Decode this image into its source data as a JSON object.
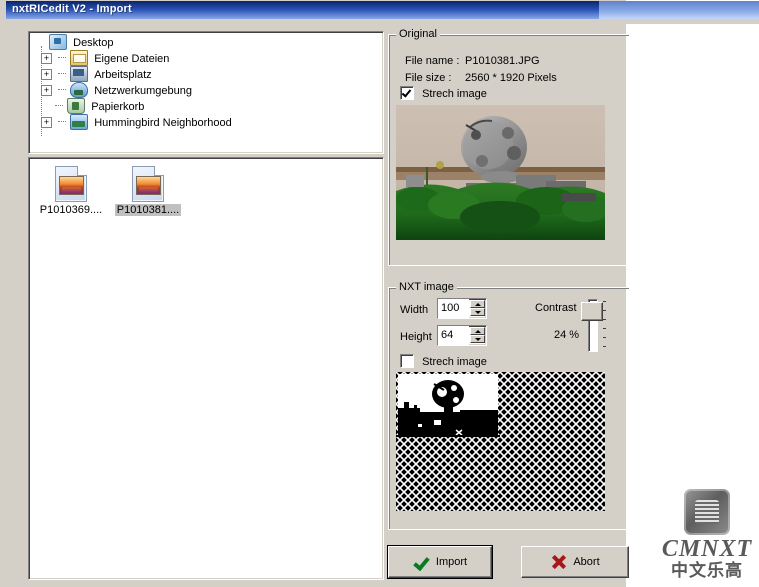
{
  "window": {
    "title": "nxtRICedit V2 - Import",
    "background_color": "#d4d0c8",
    "titlebar_color": "#0a246a"
  },
  "tree": {
    "nodes": [
      {
        "label": "Desktop",
        "icon": "desktop-icon",
        "expander": "",
        "indent": 0
      },
      {
        "label": "Eigene Dateien",
        "icon": "folder-icon",
        "expander": "+",
        "indent": 1
      },
      {
        "label": "Arbeitsplatz",
        "icon": "my-computer-icon",
        "expander": "+",
        "indent": 1
      },
      {
        "label": "Netzwerkumgebung",
        "icon": "network-icon",
        "expander": "+",
        "indent": 1
      },
      {
        "label": "Papierkorb",
        "icon": "recycle-bin-icon",
        "expander": "",
        "indent": 1
      },
      {
        "label": "Hummingbird Neighborhood",
        "icon": "hummingbird-icon",
        "expander": "+",
        "indent": 1
      }
    ]
  },
  "file_list": {
    "items": [
      {
        "label": "P1010369....",
        "icon": "jpeg-file-icon",
        "selected": false
      },
      {
        "label": "P1010381....",
        "icon": "jpeg-file-icon",
        "selected": true
      }
    ]
  },
  "original_group": {
    "title": "Original",
    "file_name_label": "File name :",
    "file_name_value": "P1010381.JPG",
    "file_size_label": "File size   :",
    "file_size_value": "2560 * 1920 Pixels",
    "stretch_label": "Strech image",
    "stretch_checked": true
  },
  "nxt_group": {
    "title": "NXT image",
    "width_label": "Width",
    "width_value": "100",
    "height_label": "Height",
    "height_value": "64",
    "contrast_label": "Contrast",
    "contrast_value": "24 %",
    "stretch_label": "Strech image",
    "stretch_checked": false
  },
  "buttons": {
    "import_label": "Import",
    "import_icon": "green-check-icon",
    "abort_label": "Abort",
    "abort_icon": "red-x-icon"
  },
  "watermark": {
    "name": "CMNXT",
    "subtitle": "中文乐高"
  }
}
